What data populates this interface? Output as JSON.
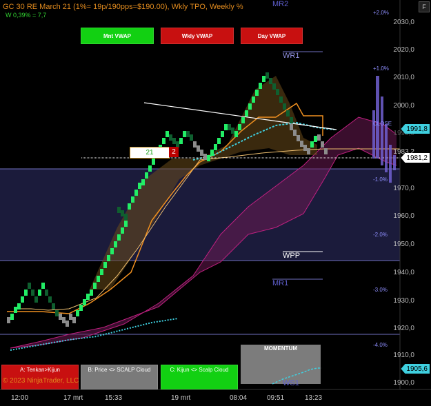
{
  "header": {
    "title": "GC 30 RE March 21  (1%= 19p/190pps=$190.00), Wkly TPO, Weekly %",
    "subtitle": "W 0,39% = 7,7"
  },
  "corner_button": "F",
  "vwap_buttons": [
    {
      "label": "Mnt VWAP",
      "color": "#12d012"
    },
    {
      "label": "Wkly VWAP",
      "color": "#c81010"
    },
    {
      "label": "Day VWAP",
      "color": "#c81010"
    }
  ],
  "bottom_buttons": [
    {
      "label": "A: Tenkan>Kijun",
      "color": "#c81010"
    },
    {
      "label": "B: Price <> SCALP Cloud",
      "color": "#7a7a7a"
    },
    {
      "label": "C: Kijun <> Scalp Cloud",
      "color": "#12d012"
    }
  ],
  "momentum": {
    "label": "MOMENTUM"
  },
  "copyright": "© 2023 NinjaTrader, LLC",
  "levels": {
    "mr2": "MR2",
    "wr1": "WR1",
    "wpp": "WPP",
    "mr1": "MR1",
    "ws1": "WS1",
    "close": "CLOSE"
  },
  "pct_labels": [
    "+2.0%",
    "+1.0%",
    "-1.0%",
    "-2.0%",
    "-3.0%",
    "-4.0%"
  ],
  "price_axis": [
    "2030,0",
    "2020,0",
    "2010,0",
    "2000,0",
    "1990,0",
    "1983,2",
    "1970,0",
    "1960,0",
    "1950,0",
    "1940,0",
    "1930,0",
    "1920,0",
    "1910,0",
    "1900,0"
  ],
  "price_tags": [
    {
      "value": "1991,8",
      "color": "#3fd0e0"
    },
    {
      "value": "1981,2",
      "color": "#ffffff"
    },
    {
      "value": "1905,6",
      "color": "#3fd0e0"
    }
  ],
  "time_axis": [
    "12:00",
    "17 mrt",
    "15:33",
    "19 mrt",
    "08:04",
    "09:51",
    "13:23"
  ],
  "bar_counter": {
    "left": "21",
    "right": "2"
  },
  "colors": {
    "bull": "#22ee66",
    "bear": "#0f5f2f",
    "neutral": "#8c8c8c",
    "orange": "#f09020",
    "cyan": "#3fd0e0",
    "cloud": "#b0207a",
    "blue": "#8888ff"
  }
}
